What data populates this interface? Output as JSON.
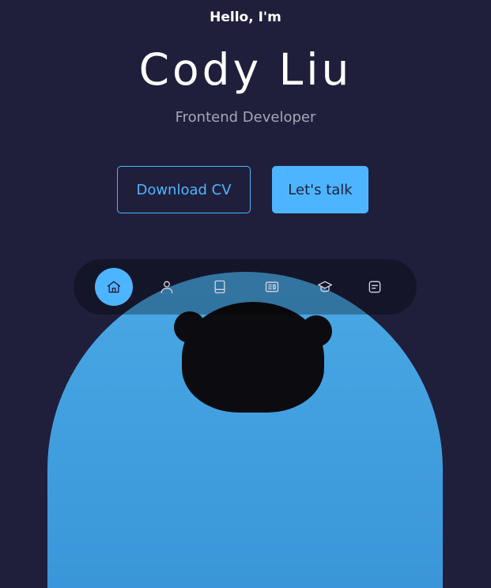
{
  "hero": {
    "greeting": "Hello, I'm",
    "name": "Cody Liu",
    "role": "Frontend Developer"
  },
  "buttons": {
    "download_cv": "Download CV",
    "lets_talk": "Let's talk"
  },
  "nav": {
    "items": [
      {
        "icon": "home-icon",
        "active": true
      },
      {
        "icon": "user-icon",
        "active": false
      },
      {
        "icon": "book-icon",
        "active": false
      },
      {
        "icon": "services-icon",
        "active": false
      },
      {
        "icon": "graduation-cap-icon",
        "active": false
      },
      {
        "icon": "message-icon",
        "active": false
      }
    ]
  },
  "colors": {
    "background": "#1f1f3c",
    "accent": "#4db5ff",
    "muted_text": "#a6a6b8"
  }
}
